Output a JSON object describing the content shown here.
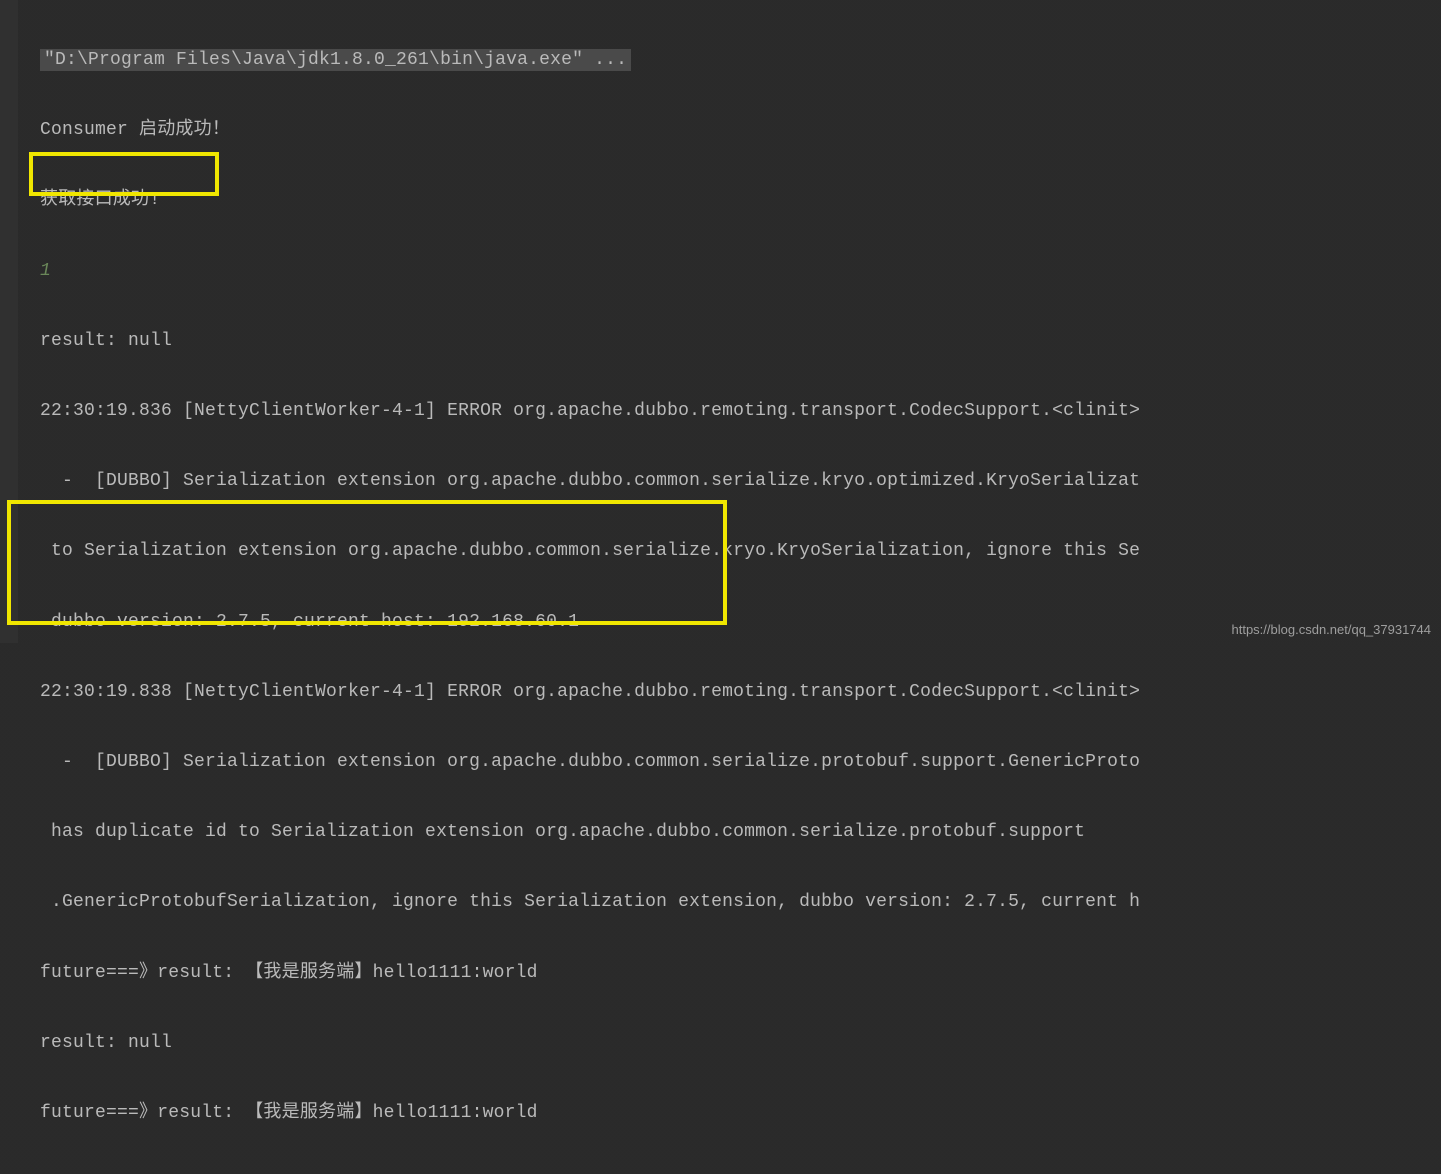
{
  "console": {
    "command": "\"D:\\Program Files\\Java\\jdk1.8.0_261\\bin\\java.exe\" ...",
    "lines": {
      "l1": "Consumer 启动成功！",
      "l2": "获取接口成功!",
      "l3": "1",
      "l4": "result: null",
      "l5": "22:30:19.836 [NettyClientWorker-4-1] ERROR org.apache.dubbo.remoting.transport.CodecSupport.<clinit>",
      "l6": "  -  [DUBBO] Serialization extension org.apache.dubbo.common.serialize.kryo.optimized.KryoSerializat",
      "l7": " to Serialization extension org.apache.dubbo.common.serialize.kryo.KryoSerialization, ignore this Se",
      "l8": " dubbo version: 2.7.5, current host: 192.168.60.1",
      "l9": "22:30:19.838 [NettyClientWorker-4-1] ERROR org.apache.dubbo.remoting.transport.CodecSupport.<clinit>",
      "l10": "  -  [DUBBO] Serialization extension org.apache.dubbo.common.serialize.protobuf.support.GenericProto",
      "l11": " has duplicate id to Serialization extension org.apache.dubbo.common.serialize.protobuf.support",
      "l12": " .GenericProtobufSerialization, ignore this Serialization extension, dubbo version: 2.7.5, current h",
      "l13": "future===》result: 【我是服务端】hello1111:world",
      "l14": "result: null",
      "l15": "future===》result: 【我是服务端】hello1111:world"
    }
  },
  "watermark": "https://blog.csdn.net/qq_37931744"
}
